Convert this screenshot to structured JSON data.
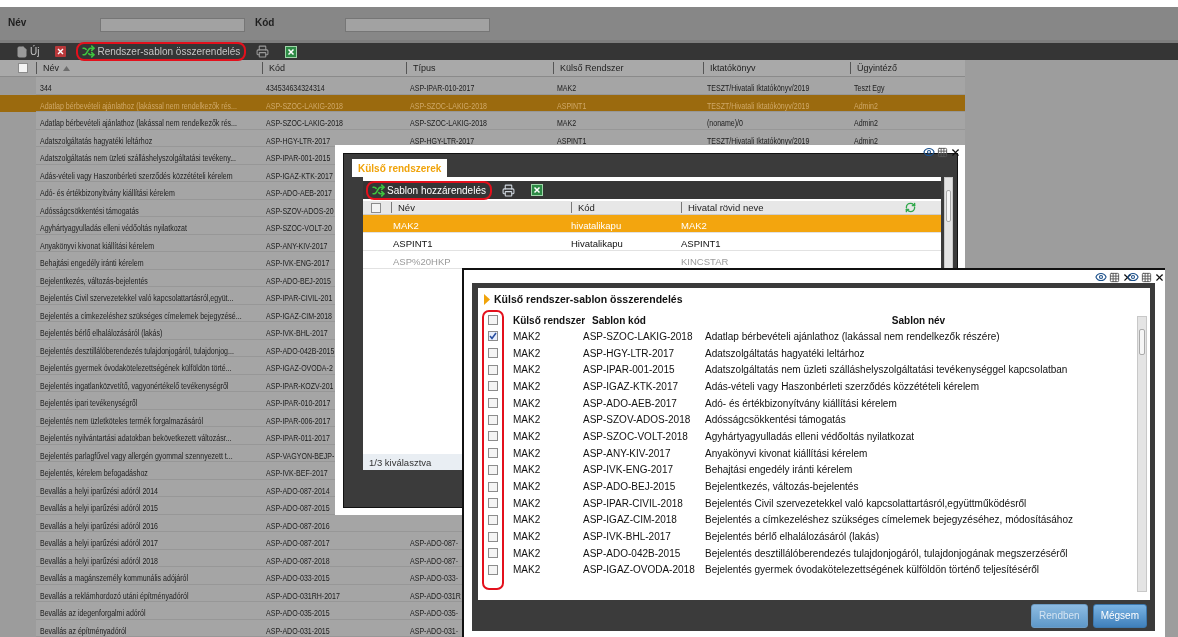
{
  "filter": {
    "fields": [
      {
        "label": "Név"
      },
      {
        "label": "Kód"
      }
    ]
  },
  "toolbar": {
    "items": [
      {
        "kind": "new",
        "label": "Új",
        "highlighted": false
      },
      {
        "kind": "delete",
        "highlighted": false
      },
      {
        "kind": "assign",
        "label": "Rendszer-sablon összerendelés",
        "highlighted": true
      },
      {
        "kind": "print",
        "highlighted": false
      },
      {
        "kind": "excel",
        "highlighted": false
      }
    ]
  },
  "table": {
    "all_checked": false,
    "columns": [
      {
        "label": "Név",
        "sorted": true
      },
      {
        "label": "Kód",
        "sorted": false
      },
      {
        "label": "Típus",
        "sorted": false
      },
      {
        "label": "Külső Rendszer",
        "sorted": false
      },
      {
        "label": "Iktatókönyv",
        "sorted": false
      },
      {
        "label": "Ügyintéző",
        "sorted": false
      }
    ],
    "rows": [
      {
        "selected": false,
        "cells": [
          "344",
          "434534634324314",
          "ASP-IPAR-010-2017",
          "MAK2",
          "TESZT/Hivatali Iktatókönyv/2019",
          "Teszt Egy"
        ]
      },
      {
        "selected": true,
        "cells": [
          "Adatlap bérbevételi ajánlathoz (lakással nem rendelkezők rés...",
          "ASP-SZOC-LAKIG-2018",
          "ASP-SZOC-LAKIG-2018",
          "ASPINT1",
          "TESZT/Hivatali Iktatókönyv/2019",
          "Admin2"
        ]
      },
      {
        "selected": false,
        "cells": [
          "Adatlap bérbevételi ajánlathoz (lakással nem rendelkezők rés...",
          "ASP-SZOC-LAKIG-2018",
          "ASP-SZOC-LAKIG-2018",
          "MAK2",
          "(noname)/0",
          "Admin2"
        ]
      },
      {
        "selected": false,
        "cells": [
          "Adatszolgáltatás hagyatéki leltárhoz",
          "ASP-HGY-LTR-2017",
          "ASP-HGY-LTR-2017",
          "ASPINT1",
          "TESZT/Hivatali Iktatókönyv/2019",
          "Admin2"
        ]
      },
      {
        "selected": false,
        "cells": [
          "Adatszolgáltatás nem üzleti szálláshelyszolgáltatási tevékeny...",
          "ASP-IPAR-001-2015"
        ]
      },
      {
        "selected": false,
        "cells": [
          "Adás-vételi vagy Haszonbérleti szerződés közzétételi kérelem",
          "ASP-IGAZ-KTK-2017"
        ]
      },
      {
        "selected": false,
        "cells": [
          "Adó- és értékbizonyítvány kiállítási kérelem",
          "ASP-ADO-AEB-2017"
        ]
      },
      {
        "selected": false,
        "cells": [
          "Adósságcsökkentési támogatás",
          "ASP-SZOV-ADOS-20"
        ]
      },
      {
        "selected": false,
        "cells": [
          "Agyhártyagyulladás elleni védőoltás nyilatkozat",
          "ASP-SZOC-VOLT-20"
        ]
      },
      {
        "selected": false,
        "cells": [
          "Anyakönyvi kivonat kiállítási kérelem",
          "ASP-ANY-KIV-2017"
        ]
      },
      {
        "selected": false,
        "cells": [
          "Behajtási engedély iránti kérelem",
          "ASP-IVK-ENG-2017"
        ]
      },
      {
        "selected": false,
        "cells": [
          "Bejelentkezés, változás-bejelentés",
          "ASP-ADO-BEJ-2015"
        ]
      },
      {
        "selected": false,
        "cells": [
          "Bejelentés Civil szervezetekkel való kapcsolattartásról,együt...",
          "ASP-IPAR-CIVIL-201"
        ]
      },
      {
        "selected": false,
        "cells": [
          "Bejelentés a címkezeléshez szükséges címelemek bejegyzésé...",
          "ASP-IGAZ-CIM-2018"
        ]
      },
      {
        "selected": false,
        "cells": [
          "Bejelentés bérlő elhalálozásáról (lakás)",
          "ASP-IVK-BHL-2017"
        ]
      },
      {
        "selected": false,
        "cells": [
          "Bejelentés desztillálóberendezés tulajdonjogáról, tulajdonjog...",
          "ASP-ADO-042B-2015"
        ]
      },
      {
        "selected": false,
        "cells": [
          "Bejelentés gyermek óvodakötelezettségének külföldön törté...",
          "ASP-IGAZ-OVODA-2"
        ]
      },
      {
        "selected": false,
        "cells": [
          "Bejelentés ingatlanközvetítő, vagyonértékelő tevékenységről",
          "ASP-IPAR-KOZV-201"
        ]
      },
      {
        "selected": false,
        "cells": [
          "Bejelentés ipari tevékenységről",
          "ASP-IPAR-010-2017"
        ]
      },
      {
        "selected": false,
        "cells": [
          "Bejelentés nem üzletköteles termék forgalmazásáról",
          "ASP-IPAR-006-2017"
        ]
      },
      {
        "selected": false,
        "cells": [
          "Bejelentés nyilvántartási adatokban bekövetkezett változásr...",
          "ASP-IPAR-011-2017"
        ]
      },
      {
        "selected": false,
        "cells": [
          "Bejelentés parlagfűvel vagy allergén gyommal szennyezett t...",
          "ASP-VAGYON-BEJP-"
        ]
      },
      {
        "selected": false,
        "cells": [
          "Bejelentés, kérelem befogadáshoz",
          "ASP-IVK-BEF-2017"
        ]
      },
      {
        "selected": false,
        "cells": [
          "Bevallás a helyi iparűzési adóról 2014",
          "ASP-ADO-087-2014"
        ]
      },
      {
        "selected": false,
        "cells": [
          "Bevallás a helyi iparűzési adóról 2015",
          "ASP-ADO-087-2015"
        ]
      },
      {
        "selected": false,
        "cells": [
          "Bevallás a helyi iparűzési adóról 2016",
          "ASP-ADO-087-2016"
        ]
      },
      {
        "selected": false,
        "cells": [
          "Bevallás a helyi iparűzési adóról 2017",
          "ASP-ADO-087-2017",
          "ASP-ADO-087-"
        ]
      },
      {
        "selected": false,
        "cells": [
          "Bevallás a helyi iparűzési adóról 2018",
          "ASP-ADO-087-2018",
          "ASP-ADO-087-"
        ]
      },
      {
        "selected": false,
        "cells": [
          "Bevallás a magánszemély kommunális adójáról",
          "ASP-ADO-033-2015",
          "ASP-ADO-033-"
        ]
      },
      {
        "selected": false,
        "cells": [
          "Bevallás a reklámhordozó utáni építményadóról",
          "ASP-ADO-031RH-2017",
          "ASP-ADO-031R"
        ]
      },
      {
        "selected": false,
        "cells": [
          "Bevallás az idegenforgalmi adóról",
          "ASP-ADO-035-2015",
          "ASP-ADO-035-"
        ]
      },
      {
        "selected": false,
        "cells": [
          "Bevallás az építményadóról",
          "ASP-ADO-031-2015",
          "ASP-ADO-031-"
        ]
      }
    ]
  },
  "systems_dialog": {
    "tab": "Külső rendszerek",
    "toolbar": [
      {
        "kind": "assign",
        "label": "Sablon hozzárendelés",
        "highlighted": true
      },
      {
        "kind": "print",
        "highlighted": false
      },
      {
        "kind": "excel",
        "highlighted": false
      }
    ],
    "all_checked": false,
    "columns": [
      "Név",
      "Kód",
      "Hivatal rövid neve"
    ],
    "rows": [
      {
        "selected": true,
        "inactive": false,
        "cells": [
          "MAK2",
          "hivatalikapu",
          "MAK2"
        ]
      },
      {
        "selected": false,
        "inactive": false,
        "cells": [
          "ASPINT1",
          "Hivatalikapu",
          "ASPINT1"
        ]
      },
      {
        "selected": false,
        "inactive": true,
        "cells": [
          "ASP%20HKP",
          "",
          "KINCSTAR"
        ]
      }
    ],
    "footer": "1/3 kiválasztva"
  },
  "assign_dialog": {
    "title": "Külső rendszer-sablon összerendelés",
    "all_checked": false,
    "columns": [
      "Külső rendszer",
      "Sablon kód",
      "Sablon név"
    ],
    "rows": [
      {
        "checked": true,
        "system": "MAK2",
        "code": "ASP-SZOC-LAKIG-2018",
        "name": "Adatlap bérbevételi ajánlathoz (lakással nem rendelkezők részére)"
      },
      {
        "checked": false,
        "system": "MAK2",
        "code": "ASP-HGY-LTR-2017",
        "name": "Adatszolgáltatás hagyatéki leltárhoz"
      },
      {
        "checked": false,
        "system": "MAK2",
        "code": "ASP-IPAR-001-2015",
        "name": "Adatszolgáltatás nem üzleti szálláshelyszolgáltatási tevékenységgel kapcsolatban"
      },
      {
        "checked": false,
        "system": "MAK2",
        "code": "ASP-IGAZ-KTK-2017",
        "name": "Adás-vételi vagy Haszonbérleti szerződés közzétételi kérelem"
      },
      {
        "checked": false,
        "system": "MAK2",
        "code": "ASP-ADO-AEB-2017",
        "name": "Adó- és értékbizonyítvány kiállítási kérelem"
      },
      {
        "checked": false,
        "system": "MAK2",
        "code": "ASP-SZOV-ADOS-2018",
        "name": "Adósságcsökkentési támogatás"
      },
      {
        "checked": false,
        "system": "MAK2",
        "code": "ASP-SZOC-VOLT-2018",
        "name": "Agyhártyagyulladás elleni védőoltás nyilatkozat"
      },
      {
        "checked": false,
        "system": "MAK2",
        "code": "ASP-ANY-KIV-2017",
        "name": "Anyakönyvi kivonat kiállítási kérelem"
      },
      {
        "checked": false,
        "system": "MAK2",
        "code": "ASP-IVK-ENG-2017",
        "name": "Behajtási engedély iránti kérelem"
      },
      {
        "checked": false,
        "system": "MAK2",
        "code": "ASP-ADO-BEJ-2015",
        "name": "Bejelentkezés, változás-bejelentés"
      },
      {
        "checked": false,
        "system": "MAK2",
        "code": "ASP-IPAR-CIVIL-2018",
        "name": "Bejelentés Civil szervezetekkel való kapcsolattartásról,együttműködésről"
      },
      {
        "checked": false,
        "system": "MAK2",
        "code": "ASP-IGAZ-CIM-2018",
        "name": "Bejelentés a címkezeléshez szükséges címelemek bejegyzéséhez, módosításához"
      },
      {
        "checked": false,
        "system": "MAK2",
        "code": "ASP-IVK-BHL-2017",
        "name": "Bejelentés bérlő elhalálozásáról (lakás)"
      },
      {
        "checked": false,
        "system": "MAK2",
        "code": "ASP-ADO-042B-2015",
        "name": "Bejelentés desztillálóberendezés tulajdonjogáról, tulajdonjogának megszerzéséről"
      },
      {
        "checked": false,
        "system": "MAK2",
        "code": "ASP-IGAZ-OVODA-2018",
        "name": "Bejelentés gyermek óvodakötelezettségének külföldön történő teljesítéséről"
      }
    ],
    "buttons": [
      {
        "label": "Rendben",
        "disabled": true
      },
      {
        "label": "Mégsem",
        "disabled": false
      }
    ]
  }
}
